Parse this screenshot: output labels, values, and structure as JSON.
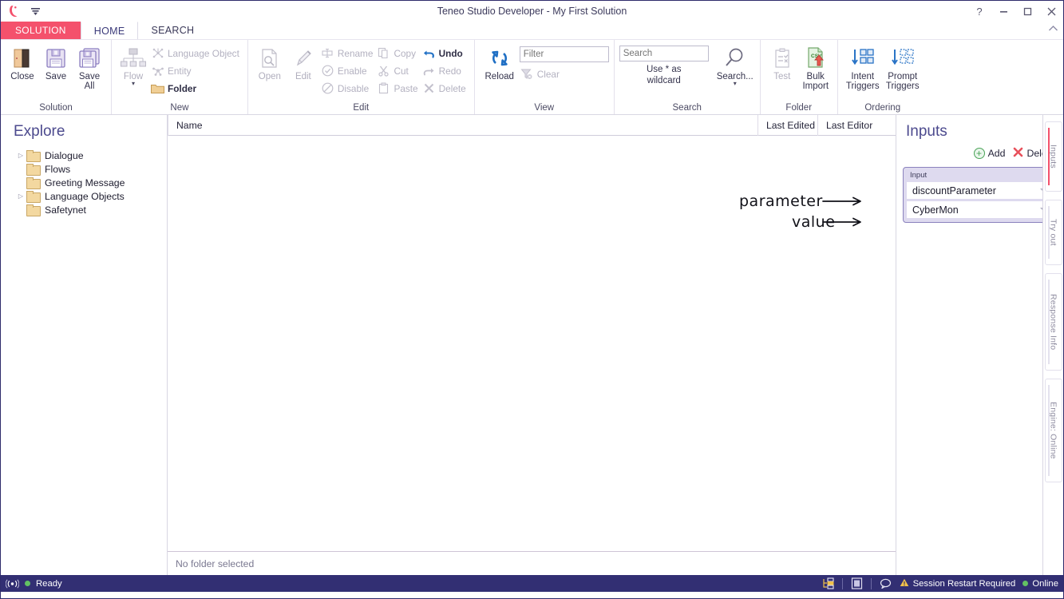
{
  "window": {
    "title": "Teneo Studio Developer - My First Solution",
    "app_icon": "teneo-logo-icon",
    "quick_access_icon": "quick-access-toolbar-icon",
    "help_label": "?",
    "minimize_label": "–",
    "maximize_label": "☐",
    "close_label": "✕",
    "ribbon_collapse_icon": "chevron-up-icon"
  },
  "ribbon_tabs": [
    {
      "label": "SOLUTION",
      "state": "accent"
    },
    {
      "label": "HOME",
      "state": "active"
    },
    {
      "label": "SEARCH",
      "state": "normal"
    }
  ],
  "ribbon": {
    "groups": [
      {
        "name": "Solution",
        "label": "Solution",
        "big_buttons": [
          {
            "label": "Close",
            "icon": "door-open-icon",
            "disabled": false
          },
          {
            "label": "Save",
            "icon": "floppy-disk-icon",
            "disabled": false
          },
          {
            "label": "Save All",
            "icon": "floppy-disk-stack-icon",
            "disabled": false
          }
        ]
      },
      {
        "name": "New",
        "label": "New",
        "big_buttons": [
          {
            "label": "Flow",
            "icon": "flow-tree-icon",
            "disabled": true,
            "has_caret": true
          }
        ],
        "small_buttons": [
          {
            "label": "Language Object",
            "icon": "language-object-icon",
            "disabled": true
          },
          {
            "label": "Entity",
            "icon": "entity-icon",
            "disabled": true
          },
          {
            "label": "Folder",
            "icon": "folder-icon",
            "disabled": false,
            "bold": true
          }
        ]
      },
      {
        "name": "Edit",
        "label": "Edit",
        "big_buttons": [
          {
            "label": "Open",
            "icon": "open-document-icon",
            "disabled": true
          },
          {
            "label": "Edit",
            "icon": "pencil-icon",
            "disabled": true
          }
        ],
        "small_columns": [
          [
            {
              "label": "Rename",
              "icon": "rename-icon",
              "disabled": true
            },
            {
              "label": "Enable",
              "icon": "check-circle-icon",
              "disabled": true
            },
            {
              "label": "Disable",
              "icon": "no-entry-icon",
              "disabled": true
            }
          ],
          [
            {
              "label": "Copy",
              "icon": "copy-icon",
              "disabled": true
            },
            {
              "label": "Cut",
              "icon": "scissors-icon",
              "disabled": true
            },
            {
              "label": "Paste",
              "icon": "clipboard-icon",
              "disabled": true
            }
          ],
          [
            {
              "label": "Undo",
              "icon": "undo-arrow-icon",
              "disabled": false,
              "bold": true
            },
            {
              "label": "Redo",
              "icon": "redo-arrow-icon",
              "disabled": true
            },
            {
              "label": "Delete",
              "icon": "delete-x-icon",
              "disabled": true
            }
          ]
        ]
      },
      {
        "name": "View",
        "label": "View",
        "big_buttons": [
          {
            "label": "Reload",
            "icon": "reload-circular-arrows-icon",
            "disabled": false
          }
        ],
        "filter_input": {
          "value": "",
          "placeholder": "Filter"
        },
        "small_buttons": [
          {
            "label": "Clear",
            "icon": "clear-filter-icon",
            "disabled": true
          }
        ]
      },
      {
        "name": "Search",
        "label": "Search",
        "search_input": {
          "value": "",
          "placeholder": "Search"
        },
        "hint_line1": "Use * as",
        "hint_line2": "wildcard",
        "big_buttons": [
          {
            "label": "Search...",
            "icon": "magnifier-icon",
            "disabled": false,
            "has_caret": true
          }
        ]
      },
      {
        "name": "Folder",
        "label": "Folder",
        "big_buttons": [
          {
            "label": "Test",
            "icon": "test-clipboard-icon",
            "disabled": true
          },
          {
            "label": "Bulk Import",
            "icon": "csv-import-icon",
            "disabled": false
          }
        ]
      },
      {
        "name": "Ordering",
        "label": "Ordering",
        "big_buttons": [
          {
            "label": "Intent Triggers",
            "icon": "intent-triggers-order-icon",
            "disabled": false
          },
          {
            "label": "Prompt Triggers",
            "icon": "prompt-triggers-order-icon",
            "disabled": false
          }
        ]
      }
    ]
  },
  "sidebar": {
    "title": "Explore",
    "items": [
      {
        "label": "Dialogue",
        "expandable": true,
        "icon": "folder-icon"
      },
      {
        "label": "Flows",
        "expandable": false,
        "icon": "folder-icon"
      },
      {
        "label": "Greeting Message",
        "expandable": false,
        "icon": "folder-icon"
      },
      {
        "label": "Language Objects",
        "expandable": true,
        "icon": "folder-icon"
      },
      {
        "label": "Safetynet",
        "expandable": false,
        "icon": "folder-icon"
      }
    ]
  },
  "grid": {
    "columns": [
      {
        "label": "Name",
        "key": "name"
      },
      {
        "label": "Last Edited",
        "key": "last_edited"
      },
      {
        "label": "Last Editor",
        "key": "last_editor"
      }
    ],
    "rows": [],
    "footer_status": "No folder selected"
  },
  "inputs_panel": {
    "title": "Inputs",
    "add_label": "Add",
    "delete_label": "Delete",
    "add_icon": "plus-circle-icon",
    "delete_icon": "red-x-icon",
    "card": {
      "group_label": "Input",
      "parameter": {
        "value": "discountParameter",
        "caret_icon": "chevron-down-icon"
      },
      "value": {
        "value": "CyberMon",
        "caret_icon": "chevron-down-icon"
      }
    },
    "accent_color": "#f4516c",
    "card_bg": "#dedaef",
    "card_border": "#8b82bd"
  },
  "vertical_tabs": [
    {
      "label": "Inputs",
      "active": true
    },
    {
      "label": "Try out",
      "active": false
    },
    {
      "label": "Response Info",
      "active": false
    },
    {
      "label": "Engine: Online",
      "active": false
    }
  ],
  "annotations": [
    {
      "text": "parameter",
      "target": "parameter-combo"
    },
    {
      "text": "value",
      "target": "value-combo"
    }
  ],
  "statusbar": {
    "connection_icon": "signal-icon",
    "status_text": "Ready",
    "right_icons": [
      {
        "icon": "solution-tree-icon"
      },
      {
        "icon": "document-icon"
      },
      {
        "icon": "chat-bubble-icon"
      }
    ],
    "session_warning_icon": "warning-triangle-icon",
    "session_warning": "Session Restart Required",
    "engine_status": "Online",
    "bg_color": "#322f73"
  }
}
